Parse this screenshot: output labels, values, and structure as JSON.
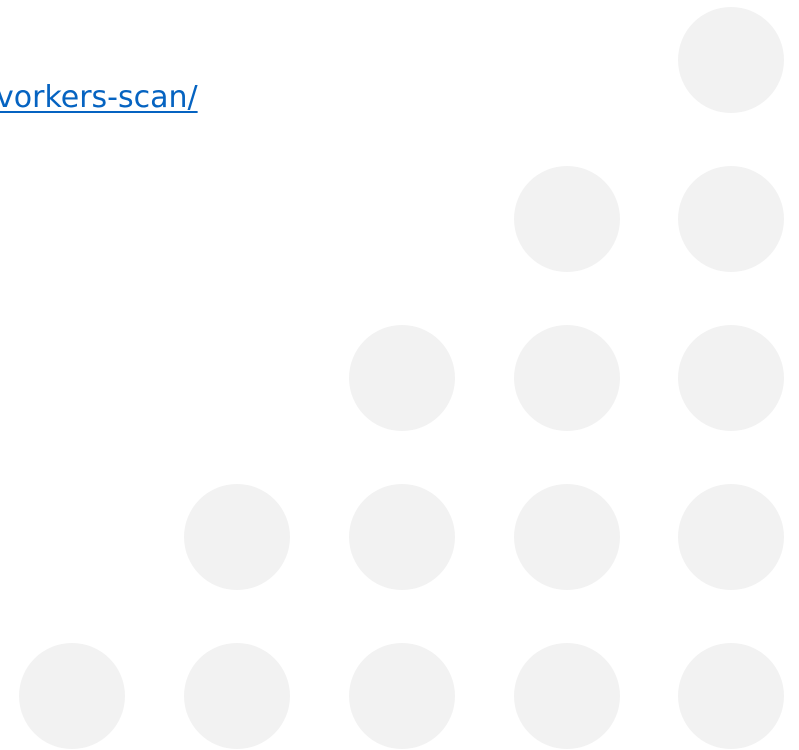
{
  "link": {
    "text": "vorkers-scan/"
  },
  "decoration": {
    "dot_color": "#f2f2f2",
    "rows": [
      1,
      2,
      3,
      4,
      5
    ]
  },
  "colors": {
    "link": "#0563c1",
    "background": "#ffffff"
  }
}
